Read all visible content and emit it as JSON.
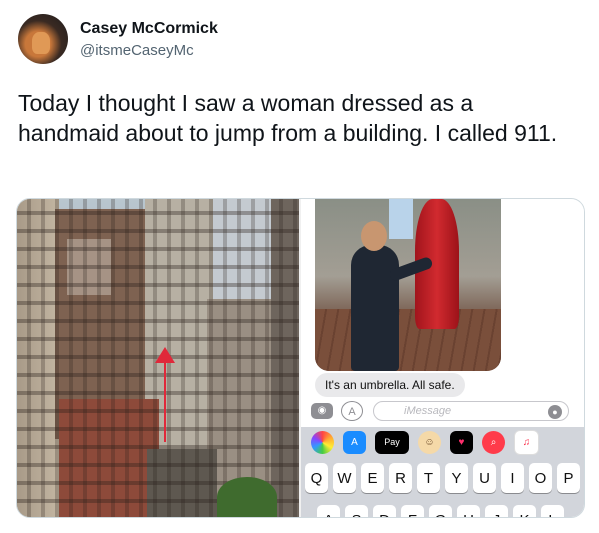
{
  "tweet": {
    "display_name": "Casey McCormick",
    "handle": "@itsmeCaseyMc",
    "text": "Today I thought I saw a woman dressed as a handmaid about to jump from a building. I called 911."
  },
  "phone": {
    "bubble_text": "It's an umbrella. All safe.",
    "input_placeholder": "iMessage",
    "camera_icon": "camera-icon",
    "apps_icon": "app-store-icon",
    "mic_icon": "microphone-icon",
    "app_pay_label": "Pay",
    "keyboard_row1": [
      "Q",
      "W",
      "E",
      "R",
      "T",
      "Y",
      "U",
      "I",
      "O",
      "P"
    ],
    "keyboard_row2": [
      "A",
      "S",
      "D",
      "F",
      "G",
      "H",
      "J",
      "K",
      "L"
    ]
  },
  "colors": {
    "arrow": "#e0283a",
    "bubble": "#e9e9eb",
    "handle": "#536471"
  }
}
